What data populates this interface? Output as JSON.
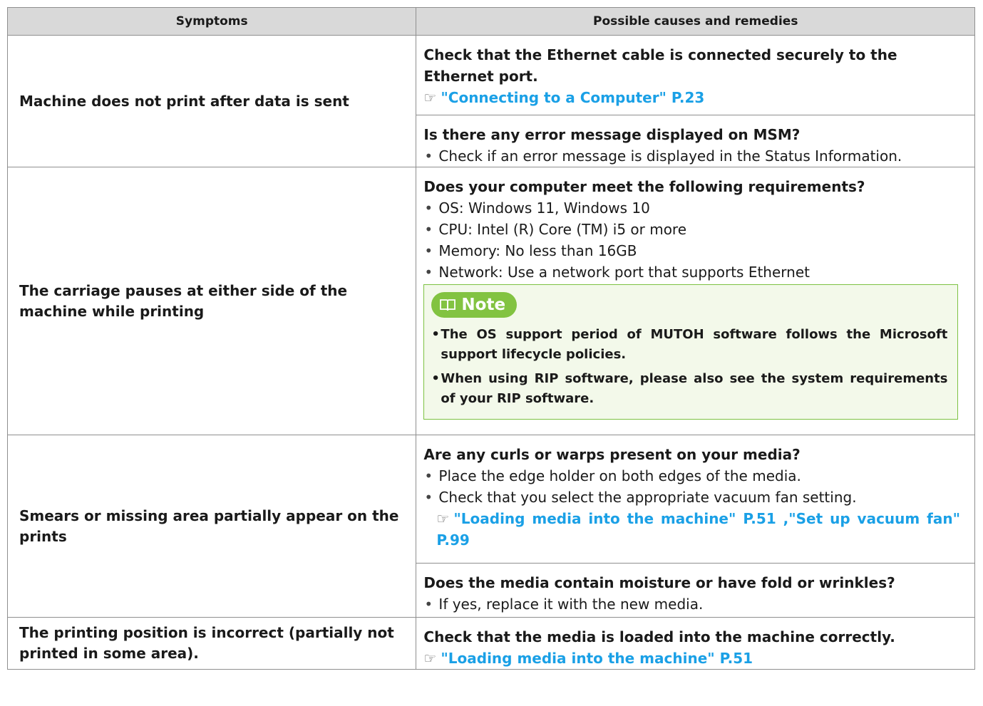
{
  "table": {
    "header": {
      "symptoms": "Symptoms",
      "causes": "Possible causes and remedies"
    },
    "rows": [
      {
        "symptom": "Machine does not print after data is sent",
        "remedy_1": {
          "heading": "Check that the Ethernet cable is connected securely to the Ethernet port.",
          "link": "\"Connecting to a Computer\" P.23"
        },
        "remedy_2": {
          "heading": "Is there any error message displayed on MSM?",
          "bullets": [
            "Check if an error message is displayed in the Status Information."
          ]
        }
      },
      {
        "symptom": "The carriage pauses at either side of the machine while printing",
        "remedy": {
          "heading": "Does your computer meet the following requirements?",
          "bullets": [
            "OS: Windows 11, Windows 10",
            "CPU: Intel (R) Core (TM) i5 or more",
            "Memory: No less than 16GB",
            "Network: Use a network port that supports Ethernet"
          ],
          "note": {
            "label": "Note",
            "items": [
              "The OS support period of MUTOH software follows the Microsoft support lifecycle policies.",
              "When using RIP software, please also see the system requirements of your RIP software."
            ]
          }
        }
      },
      {
        "symptom": "Smears or missing area partially appear on the prints",
        "remedy_1": {
          "heading": "Are any curls or warps present on your media?",
          "bullets": [
            "Place the edge holder on both edges of the media.",
            "Check that you select the appropriate vacuum fan setting."
          ],
          "link": "\"Loading media into the machine\" P.51 ,\"Set up vacuum fan\" P.99"
        },
        "remedy_2": {
          "heading": "Does the media contain moisture or have fold or wrinkles?",
          "bullets": [
            "If yes, replace it with the new media."
          ]
        }
      },
      {
        "symptom": "The printing position is incorrect (partially not printed in some area).",
        "remedy": {
          "heading": "Check that the media is loaded into the machine correctly.",
          "link": "\"Loading media into the machine\" P.51"
        }
      }
    ]
  },
  "icons": {
    "reference": "pointing-hand-icon",
    "note": "book-icon"
  },
  "colors": {
    "link": "#1aa0e6",
    "note_border": "#7dc243",
    "note_pill": "#82c341",
    "header_bg": "#d9d9d9"
  }
}
